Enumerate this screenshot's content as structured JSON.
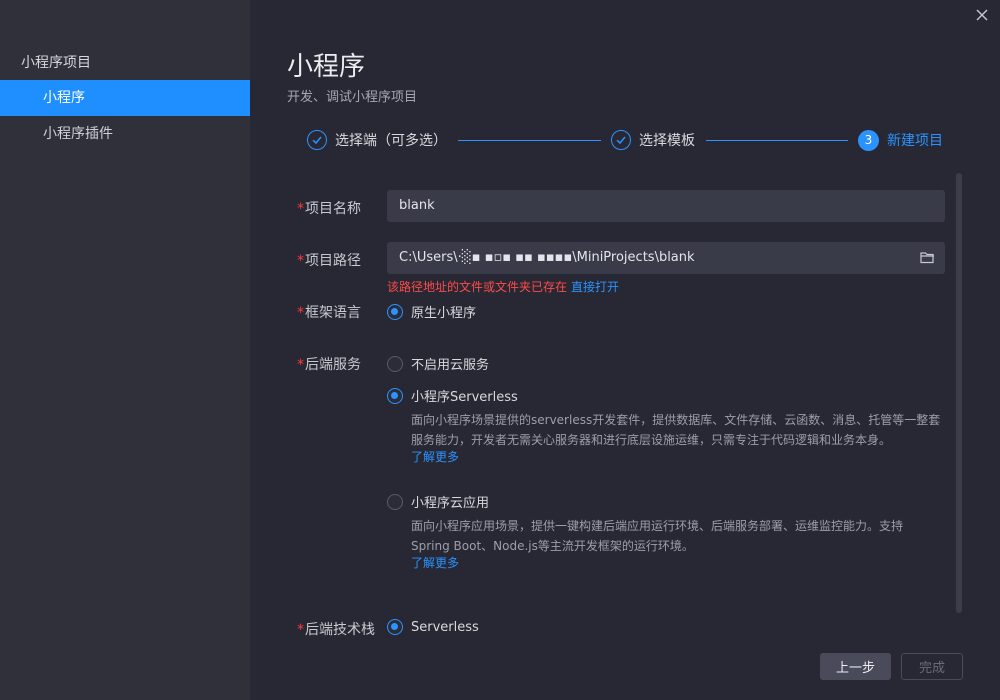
{
  "sidebar": {
    "group_title": "小程序项目",
    "items": [
      {
        "label": "小程序"
      },
      {
        "label": "小程序插件"
      }
    ]
  },
  "header": {
    "title": "小程序",
    "subtitle": "开发、调试小程序项目"
  },
  "steps": [
    {
      "label": "选择端（可多选）",
      "state": "done"
    },
    {
      "label": "选择模板",
      "state": "done"
    },
    {
      "number": "3",
      "label": "新建项目",
      "state": "current"
    }
  ],
  "form": {
    "project_name": {
      "label": "项目名称",
      "value": "blank"
    },
    "project_path": {
      "label": "项目路径",
      "value": "C:\\Users\\·░▪ ▪▫▪ ▪▪ ▪▪▪▪\\MiniProjects\\blank",
      "error": "该路径地址的文件或文件夹已存在",
      "open_link": "直接打开"
    },
    "framework": {
      "label": "框架语言",
      "option": "原生小程序"
    },
    "backend": {
      "label": "后端服务",
      "options": [
        {
          "label": "不启用云服务",
          "checked": false
        },
        {
          "label": "小程序Serverless",
          "checked": true,
          "desc_line1": "面向小程序场景提供的serverless开发套件，提供数据库、文件存储、云函数、消息、托管等一整套",
          "desc_line2": "服务能力，开发者无需关心服务器和进行底层设施运维，只需专注于代码逻辑和业务本身。",
          "more": "了解更多"
        },
        {
          "label": "小程序云应用",
          "checked": false,
          "desc_line1": "面向小程序应用场景，提供一键构建后端应用运行环境、后端服务部署、运维监控能力。支持",
          "desc_line2": "Spring Boot、Node.js等主流开发框架的运行环境。",
          "more": "了解更多"
        }
      ]
    },
    "tech_stack": {
      "label": "后端技术栈",
      "option": "Serverless"
    }
  },
  "buttons": {
    "prev": "上一步",
    "done": "完成"
  },
  "colors": {
    "accent": "#2a93ff",
    "error": "#ff4a4a",
    "background": "#272833",
    "sidebar": "#2f3039"
  }
}
